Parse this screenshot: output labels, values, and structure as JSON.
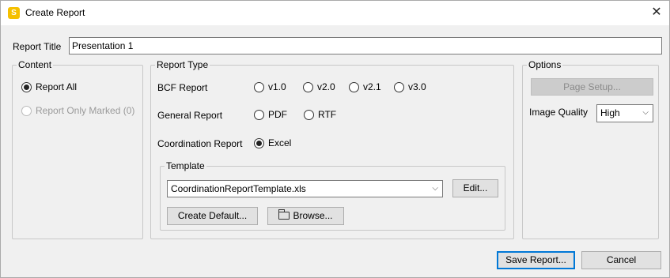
{
  "window": {
    "title": "Create Report",
    "app_icon_letter": "S",
    "close_glyph": "✕"
  },
  "report_title": {
    "label": "Report Title",
    "value": "Presentation 1"
  },
  "content": {
    "title": "Content",
    "options": [
      {
        "label": "Report All",
        "checked": true,
        "enabled": true
      },
      {
        "label": "Report Only Marked (0)",
        "checked": false,
        "enabled": false
      }
    ]
  },
  "report_type": {
    "title": "Report Type",
    "bcf": {
      "label": "BCF Report",
      "options": [
        "v1.0",
        "v2.0",
        "v2.1",
        "v3.0"
      ]
    },
    "general": {
      "label": "General Report",
      "options": [
        "PDF",
        "RTF"
      ]
    },
    "coordination": {
      "label": "Coordination Report",
      "options": [
        "Excel"
      ],
      "selected": "Excel"
    },
    "template": {
      "title": "Template",
      "selected": "CoordinationReportTemplate.xls",
      "edit_label": "Edit...",
      "create_default_label": "Create Default...",
      "browse_label": "Browse..."
    }
  },
  "options": {
    "title": "Options",
    "page_setup_label": "Page Setup...",
    "image_quality_label": "Image Quality",
    "image_quality_value": "High"
  },
  "footer": {
    "save_label": "Save Report...",
    "cancel_label": "Cancel"
  },
  "icons": {
    "chevron": "⌵"
  }
}
